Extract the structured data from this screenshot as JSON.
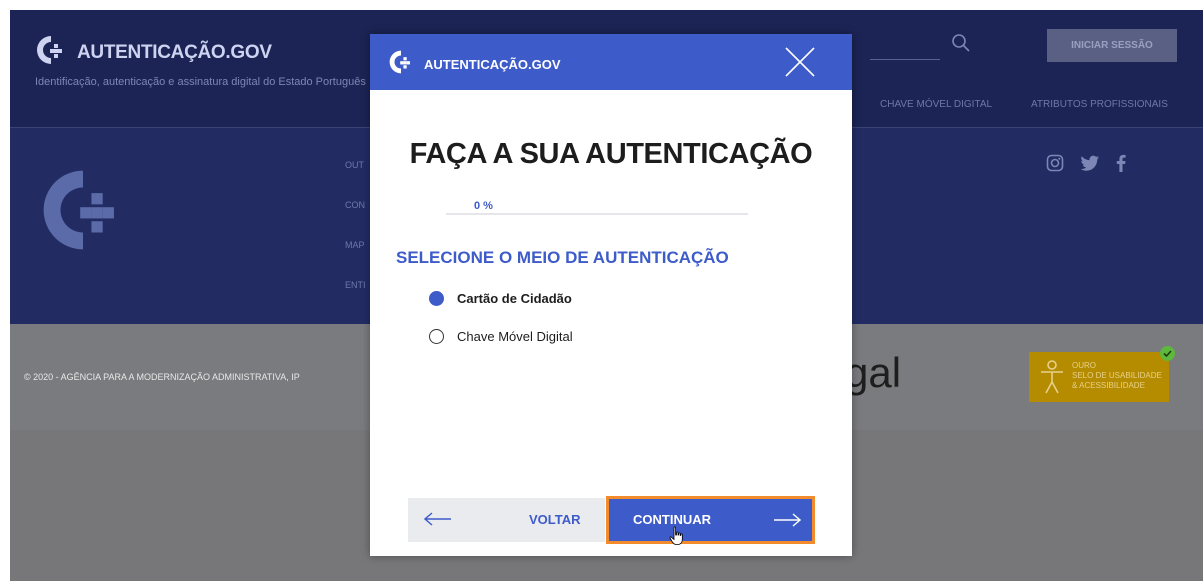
{
  "background": {
    "header": {
      "brand": "AUTENTICAÇÃO.GOV",
      "tagline": "Identificação, autenticação e assinatura digital do Estado Português",
      "login_label": "INICIAR SESSÃO",
      "nav": [
        "CHAVE MÓVEL DIGITAL",
        "ATRIBUTOS PROFISSIONAIS"
      ],
      "search_icon": "search-icon"
    },
    "footer": {
      "links": [
        "OUT",
        "CON",
        "MAP",
        "ENTI"
      ],
      "social_icons": [
        "instagram-icon",
        "twitter-icon",
        "facebook-icon"
      ],
      "copyright": "© 2020 - AGÊNCIA PARA A MODERNIZAÇÃO ADMINISTRATIVA, IP",
      "portugal_fragment": "gal",
      "badge": {
        "line1": "OURO",
        "line2": "SELO DE USABILIDADE",
        "line3": "& ACESSIBILIDADE"
      }
    }
  },
  "modal": {
    "brand": "AUTENTICAÇÃO.GOV",
    "title": "FAÇA A SUA AUTENTICAÇÃO",
    "progress_label": "0 %",
    "progress_value": 0,
    "subtitle": "SELECIONE O MEIO DE AUTENTICAÇÃO",
    "options": [
      {
        "label": "Cartão de Cidadão",
        "selected": true
      },
      {
        "label": "Chave Móvel Digital",
        "selected": false
      }
    ],
    "back_label": "VOLTAR",
    "continue_label": "CONTINUAR"
  },
  "colors": {
    "header_bg": "#1b2454",
    "footer_bg": "#222c63",
    "modal_accent": "#3d5bc9",
    "focus_outline": "#f28b2b",
    "badge_gold": "#b58b00"
  }
}
